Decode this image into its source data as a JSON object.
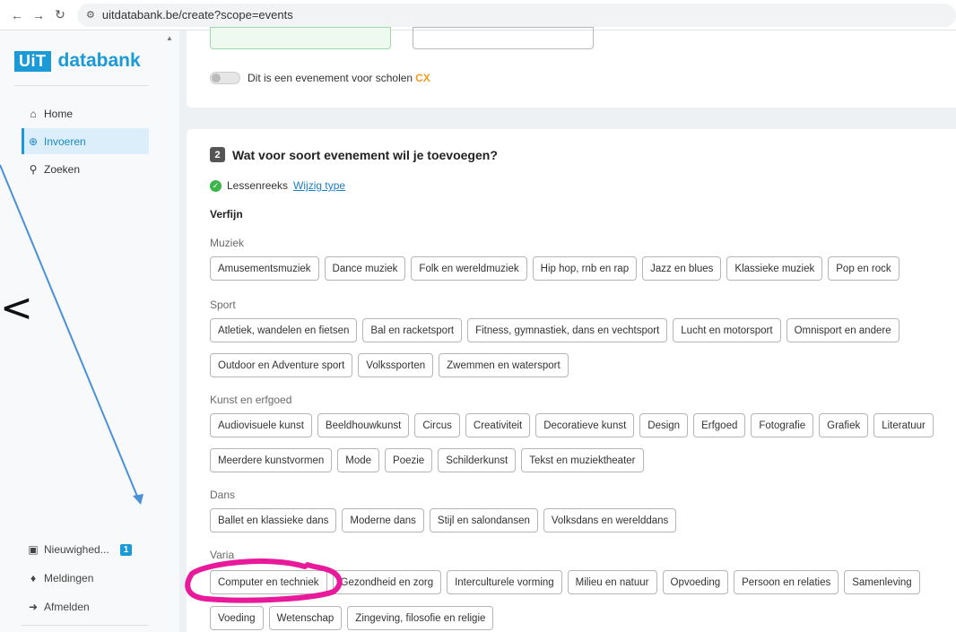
{
  "browser": {
    "url": "uitdatabank.be/create?scope=events"
  },
  "sidebar": {
    "logo_box": "UiT",
    "logo_text": "databank",
    "nav": [
      {
        "label": "Home",
        "icon": "home-icon"
      },
      {
        "label": "Invoeren",
        "icon": "plus-circle-icon"
      },
      {
        "label": "Zoeken",
        "icon": "search-icon"
      }
    ],
    "bottom": [
      {
        "label": "Nieuwighed...",
        "icon": "gift-icon",
        "badge": "1"
      },
      {
        "label": "Meldingen",
        "icon": "bell-icon"
      },
      {
        "label": "Afmelden",
        "icon": "sign-out-icon"
      }
    ]
  },
  "top_card": {
    "toggle_label": "Dit is een evenement voor scholen",
    "cx_mark": "CX"
  },
  "step2": {
    "number": "2",
    "title": "Wat voor soort evenement wil je toevoegen?",
    "selected_type": "Lessenreeks",
    "change_link": "Wijzig type",
    "refine_label": "Verfijn",
    "categories": [
      {
        "label": "Muziek",
        "rows": [
          [
            "Amusementsmuziek",
            "Dance muziek",
            "Folk en wereldmuziek",
            "Hip hop, rnb en rap",
            "Jazz en blues",
            "Klassieke muziek",
            "Pop en rock"
          ]
        ]
      },
      {
        "label": "Sport",
        "rows": [
          [
            "Atletiek, wandelen en fietsen",
            "Bal en racketsport",
            "Fitness, gymnastiek, dans en vechtsport",
            "Lucht en motorsport",
            "Omnisport en andere"
          ],
          [
            "Outdoor en Adventure sport",
            "Volkssporten",
            "Zwemmen en watersport"
          ]
        ]
      },
      {
        "label": "Kunst en erfgoed",
        "rows": [
          [
            "Audiovisuele kunst",
            "Beeldhouwkunst",
            "Circus",
            "Creativiteit",
            "Decoratieve kunst",
            "Design",
            "Erfgoed",
            "Fotografie",
            "Grafiek",
            "Literatuur"
          ],
          [
            "Meerdere kunstvormen",
            "Mode",
            "Poezie",
            "Schilderkunst",
            "Tekst en muziektheater"
          ]
        ]
      },
      {
        "label": "Dans",
        "rows": [
          [
            "Ballet en klassieke dans",
            "Moderne dans",
            "Stijl en salondansen",
            "Volksdans en werelddans"
          ]
        ]
      },
      {
        "label": "Varia",
        "rows": [
          [
            "Computer en techniek",
            "Gezondheid en zorg",
            "Interculturele vorming",
            "Milieu en natuur",
            "Opvoeding",
            "Persoon en relaties",
            "Samenleving"
          ],
          [
            "Voeding",
            "Wetenschap",
            "Zingeving, filosofie en religie"
          ]
        ]
      }
    ]
  },
  "annotation": {
    "glyph": "<",
    "arrow_color": "#4a90d9",
    "highlight_color": "#e8199a"
  }
}
